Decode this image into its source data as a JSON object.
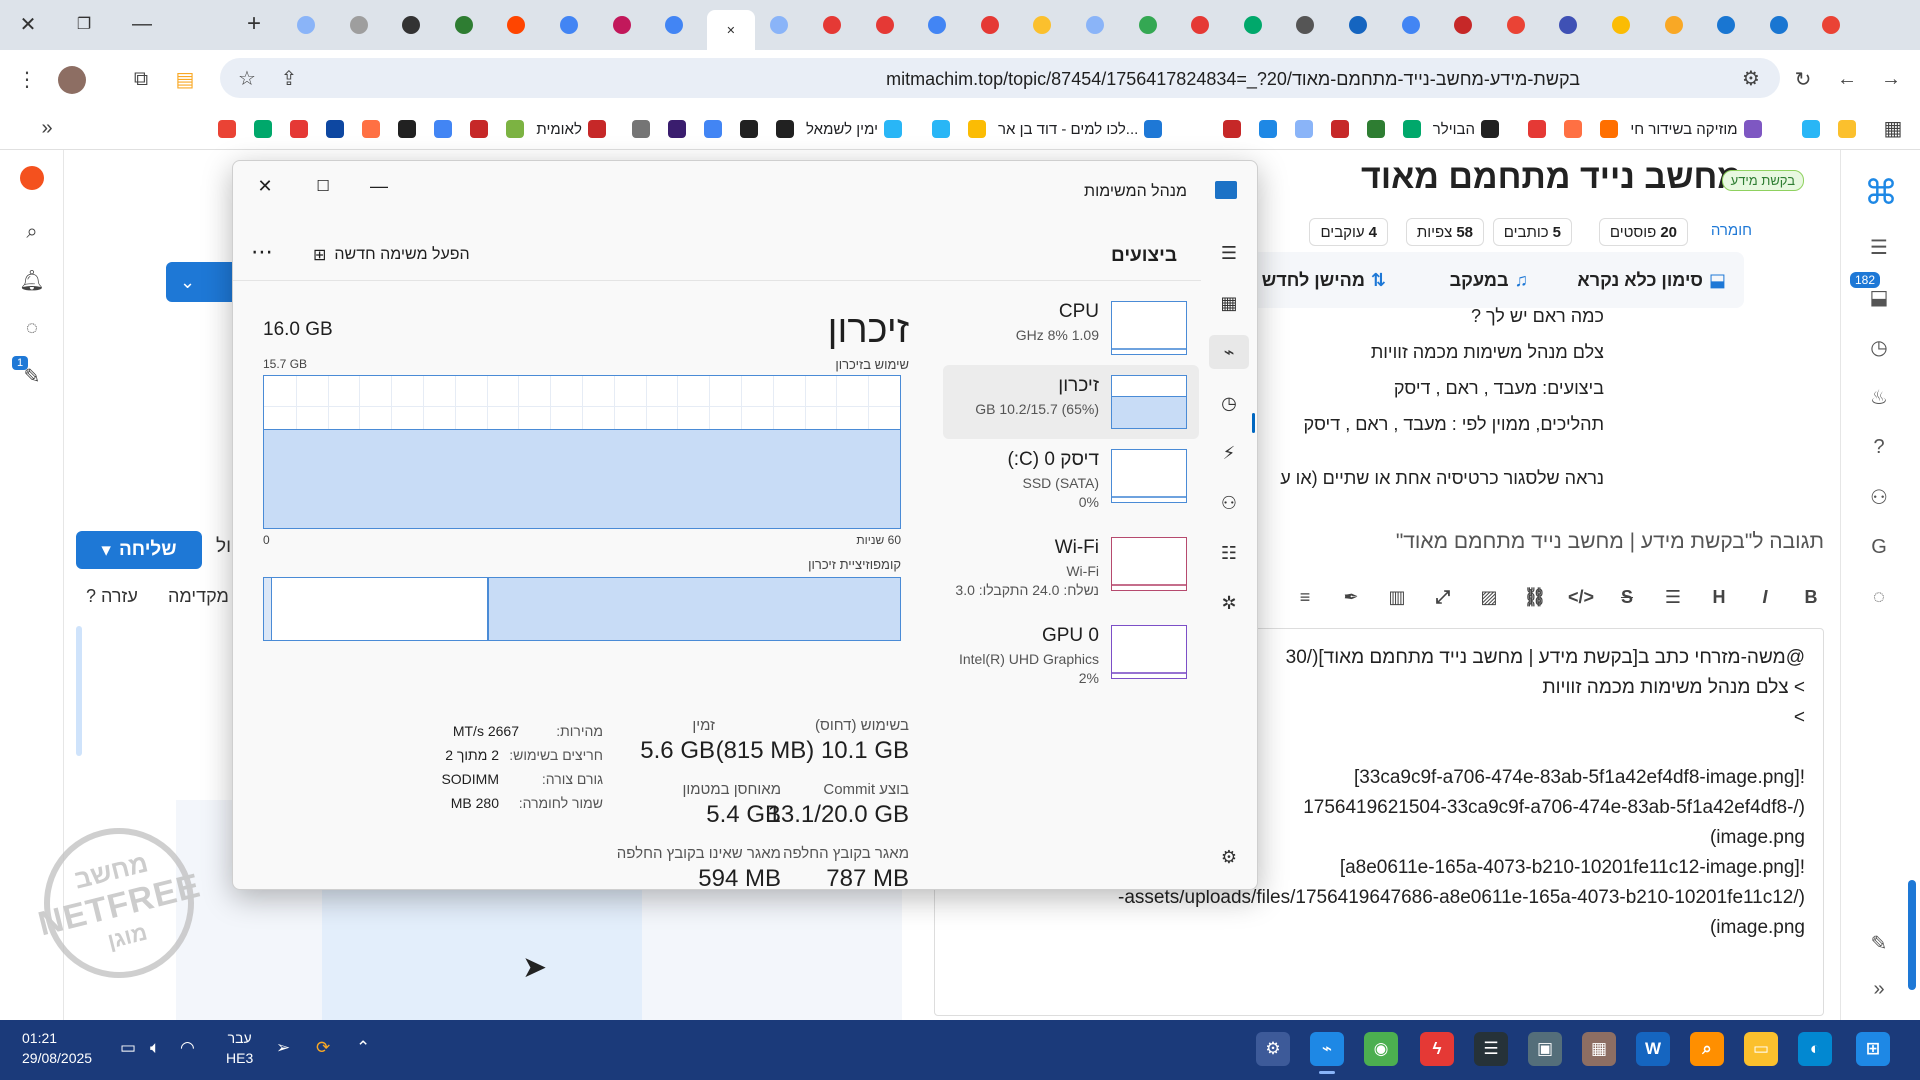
{
  "browser": {
    "url": "mitmachim.top/topic/87454/1756417824834=_?20/בקשת-מידע-מחשב-נייד-מתחמם-מאוד",
    "tabs": [
      {
        "icon": "slack-icon",
        "color": "#8ab4f8",
        "active": false
      },
      {
        "icon": "globe-icon",
        "color": "#9e9e9e",
        "active": false
      },
      {
        "icon": "brush-icon",
        "color": "#333333",
        "active": false
      },
      {
        "icon": "hebrew-icon",
        "color": "#2e7d32",
        "active": false
      },
      {
        "icon": "reddit-icon",
        "color": "#ff4500",
        "active": false
      },
      {
        "icon": "google-icon",
        "color": "#4285f4",
        "active": false
      },
      {
        "icon": "puzzle-icon",
        "color": "#c2185b",
        "active": false
      },
      {
        "icon": "google-icon",
        "color": "#4285f4",
        "active": false
      },
      {
        "icon": "close-icon",
        "color": "#444444",
        "active": true
      },
      {
        "icon": "slack-icon",
        "color": "#8ab4f8",
        "active": false
      },
      {
        "icon": "wave-icon",
        "color": "#e53935",
        "active": false
      },
      {
        "icon": "wave-icon",
        "color": "#e53935",
        "active": false
      },
      {
        "icon": "google-icon",
        "color": "#4285f4",
        "active": false
      },
      {
        "icon": "wave-icon",
        "color": "#e53935",
        "active": false
      },
      {
        "icon": "palette-icon",
        "color": "#fbc02d",
        "active": false
      },
      {
        "icon": "slack-icon",
        "color": "#8ab4f8",
        "active": false
      },
      {
        "icon": "chrome-icon",
        "color": "#34a853",
        "active": false
      },
      {
        "icon": "diamond-icon",
        "color": "#e53935",
        "active": false
      },
      {
        "icon": "green-doc-icon",
        "color": "#00a86b",
        "active": false
      },
      {
        "icon": "person-icon",
        "color": "#555555",
        "active": false
      },
      {
        "icon": "person-icon",
        "color": "#1565c0",
        "active": false
      },
      {
        "icon": "google-icon",
        "color": "#4285f4",
        "active": false
      },
      {
        "icon": "shield-icon",
        "color": "#c62828",
        "active": false
      },
      {
        "icon": "gmail-icon",
        "color": "#ea4335",
        "active": false
      },
      {
        "icon": "group-icon",
        "color": "#3f51b5",
        "active": false
      },
      {
        "icon": "drive-icon",
        "color": "#fbbc04",
        "active": false
      },
      {
        "icon": "yellow-icon",
        "color": "#f9a825",
        "active": false
      },
      {
        "icon": "group-icon",
        "color": "#1976d2",
        "active": false
      },
      {
        "icon": "group-icon",
        "color": "#1976d2",
        "active": false
      },
      {
        "icon": "gmail-icon",
        "color": "#ea4335",
        "active": false
      }
    ],
    "bookmarks": [
      {
        "label": "",
        "icon": "b-icon",
        "color": "#fbc02d"
      },
      {
        "label": "",
        "icon": "circle-icon",
        "color": "#29b6f6"
      },
      {
        "label": "מוזיקה בשידור חי",
        "icon": "music-icon",
        "color": "#7e57c2"
      },
      {
        "label": "",
        "icon": "label-icon",
        "color": "#ff6f00"
      },
      {
        "label": "",
        "icon": "square-icon",
        "color": "#ff7043"
      },
      {
        "label": "",
        "icon": "red-icon",
        "color": "#e53935"
      },
      {
        "label": "הבוילר",
        "icon": "i-icon",
        "color": "#212121"
      },
      {
        "label": "",
        "icon": "person-icon",
        "color": "#00a86b"
      },
      {
        "label": "",
        "icon": "x-icon",
        "color": "#2e7d32"
      },
      {
        "label": "",
        "icon": "shield-icon",
        "color": "#c62828"
      },
      {
        "label": "",
        "icon": "slack-icon",
        "color": "#8ab4f8"
      },
      {
        "label": "",
        "icon": "circle-icon",
        "color": "#1e88e5"
      },
      {
        "label": "",
        "icon": "shield-icon",
        "color": "#c62828"
      },
      {
        "label": "לכו למים - דוד בן אר...",
        "icon": "blue-icon",
        "color": "#1e78d6"
      },
      {
        "label": "",
        "icon": "drive-icon",
        "color": "#fbbc04"
      },
      {
        "label": "",
        "icon": "circle-icon",
        "color": "#29b6f6"
      },
      {
        "label": "ימין לשמאל",
        "icon": "circle-icon",
        "color": "#29b6f6"
      },
      {
        "label": "",
        "icon": "globe-icon",
        "color": "#212121"
      },
      {
        "label": "",
        "icon": "g-icon",
        "color": "#212121"
      },
      {
        "label": "",
        "icon": "pinwheel-icon",
        "color": "#4285f4"
      },
      {
        "label": "",
        "icon": "dark-icon",
        "color": "#3a1d6e"
      },
      {
        "label": "",
        "icon": "shield-icon",
        "color": "#757575"
      },
      {
        "label": "לאומית",
        "icon": "shield-icon",
        "color": "#c62828"
      },
      {
        "label": "",
        "icon": "leaf-icon",
        "color": "#7cb342"
      },
      {
        "label": "",
        "icon": "shield-icon",
        "color": "#c62828"
      },
      {
        "label": "",
        "icon": "google-icon",
        "color": "#4285f4"
      },
      {
        "label": "",
        "icon": "chrome-icon",
        "color": "#212121"
      },
      {
        "label": "",
        "icon": "fox-icon",
        "color": "#ff7043"
      },
      {
        "label": "",
        "icon": "flag-icon",
        "color": "#0d47a1"
      },
      {
        "label": "",
        "icon": "diamond-icon",
        "color": "#e53935"
      },
      {
        "label": "",
        "icon": "green-doc-icon",
        "color": "#00a86b"
      },
      {
        "label": "",
        "icon": "gmail-icon",
        "color": "#ea4335"
      }
    ]
  },
  "forum": {
    "title": "מחשב נייד מתחמם מאוד",
    "badge": "בקשת מידע",
    "category": "חומרה",
    "stats": [
      {
        "num": "20",
        "label": "פוסטים"
      },
      {
        "num": "5",
        "label": "כותבים"
      },
      {
        "num": "58",
        "label": "צפיות"
      },
      {
        "num": "4",
        "label": "עוקבים"
      }
    ],
    "actions": {
      "mark_read": "סימון כלא נקרא",
      "tracking": "במעקב",
      "sort": "מהישן לחדש"
    },
    "post_lines": [
      "כמה ראם יש לך ?",
      "צלם מנהל משימות מכמה זוויות",
      "ביצועים: מעבד , ראם , דיסק",
      "תהליכים, ממוין לפי : מעבד , ראם , דיסק",
      "נראה שלסגור כרטיסיה אחת או שתיים (או ע"
    ],
    "reply_header": "תגובה ל\"בקשת מידע | מחשב נייד מתחמם מאוד\"",
    "editor_lines": [
      "@משה-מזרחי כתב ב[בקשת מידע | מחשב נייד מתחמם מאוד](/30",
      "> צלם מנהל משימות מכמה זוויות",
      ">",
      "![33ca9c9f-a706-474e-83ab-5f1a42ef4df8-image.png]",
      "(/-1756419621504-33ca9c9f-a706-474e-83ab-5f1a42ef4df8",
      "image.png)",
      "![a8e0611e-165a-4073-b210-10201fe11c12-image.png]",
      "(/assets/uploads/files/1756419647686-a8e0611e-165a-4073-b210-10201fe11c12-",
      "image.png)"
    ],
    "send_label": "שליחה",
    "help_label": "? עזרה",
    "preview_label": "מקדימה",
    "cut_label": "ול",
    "notification_count": "182",
    "chat_badge": "1",
    "watermark": [
      "מחשב",
      "NETFREE",
      "מוגן"
    ]
  },
  "taskmgr": {
    "title": "מנהל המשימות",
    "section": "ביצועים",
    "run_task": "הפעל משימה חדשה",
    "devices": [
      {
        "name": "CPU",
        "sub1": "1.09 GHz  8%",
        "sub2": "",
        "sub3": "",
        "selected": false,
        "color": "#4a8bd6"
      },
      {
        "name": "זיכרון",
        "sub1": "(65%) 10.2/15.7 GB",
        "sub2": "",
        "sub3": "",
        "selected": true,
        "color": "#4a8bd6"
      },
      {
        "name": "דיסק 0 (C:)",
        "sub1": "SSD (SATA)",
        "sub2": "0%",
        "sub3": "",
        "selected": false,
        "color": "#4a8bd6"
      },
      {
        "name": "Wi-Fi",
        "sub1": "Wi-Fi",
        "sub2": "נשלח: 24.0 התקבלו: 3.0",
        "sub3": "",
        "selected": false,
        "color": "#b64a6e"
      },
      {
        "name": "GPU 0",
        "sub1": "Intel(R) UHD Graphics",
        "sub2": "2%",
        "sub3": "",
        "selected": false,
        "color": "#7c4fc7"
      }
    ],
    "memory": {
      "title": "זיכרון",
      "total": "16.0 GB",
      "usage_label": "שימוש בזיכרון",
      "usage_max": "15.7 GB",
      "usage_fraction": 0.65,
      "axis_left": "0",
      "axis_right": "60 שניות",
      "composition_label": "קומפוזיציית זיכרון",
      "composition_used_fraction": 0.65,
      "in_use_label": "בשימוש (דחוס)",
      "in_use_value": "(815 MB) 10.1 GB",
      "available_label": "זמין",
      "available_value": "5.6 GB",
      "committed_label": "בוצע Commit",
      "committed_value": "13.1/20.0 GB",
      "cached_label": "מאוחסן במטמון",
      "cached_value": "5.4 GB",
      "paged_label": "מאגר בקובץ החלפה",
      "paged_value": "787 MB",
      "nonpaged_label": "מאגר שאינו בקובץ החלפה",
      "nonpaged_value": "594 MB",
      "speed_label": "מהירות:",
      "speed_value": "2667 MT/s",
      "slots_label": "חריצים בשימוש:",
      "slots_value": "2 מתוך 2",
      "form_label": "גורם צורה:",
      "form_value": "SODIMM",
      "reserved_label": "שמור לחומרה:",
      "reserved_value": "280 MB"
    }
  },
  "taskbar": {
    "time": "01:21",
    "date": "29/08/2025",
    "lang1": "עבר",
    "lang2": "HE3"
  }
}
